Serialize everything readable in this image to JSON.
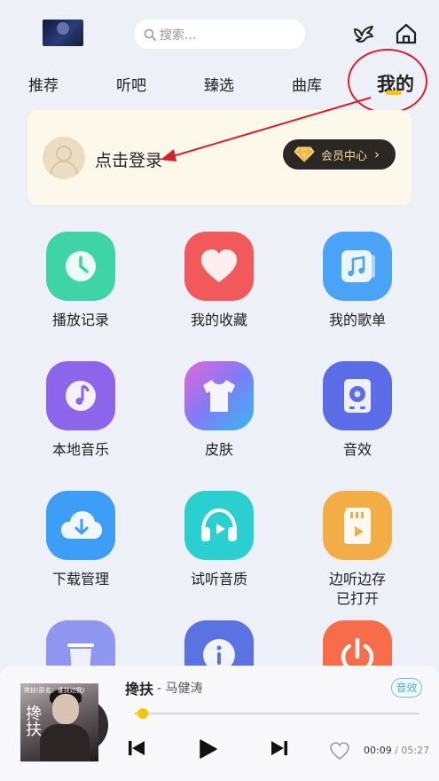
{
  "header": {
    "search_placeholder": "搜索...",
    "tabs": [
      {
        "label": "推荐"
      },
      {
        "label": "听吧"
      },
      {
        "label": "臻选"
      },
      {
        "label": "曲库"
      },
      {
        "label": "我的",
        "active": true
      }
    ]
  },
  "login_card": {
    "login_text": "点击登录",
    "vip_label": "会员中心"
  },
  "grid": [
    {
      "label": "播放记录",
      "icon": "clock-icon",
      "color": "#3fd4a5"
    },
    {
      "label": "我的收藏",
      "icon": "heart-icon",
      "color": "#f2595a"
    },
    {
      "label": "我的歌单",
      "icon": "playlist-icon",
      "color": "#4aa3f6"
    },
    {
      "label": "本地音乐",
      "icon": "music-note-icon",
      "color": "#8d65ea"
    },
    {
      "label": "皮肤",
      "icon": "tshirt-icon",
      "color": "#6c7cf5"
    },
    {
      "label": "音效",
      "icon": "speaker-icon",
      "color": "#5a6ce6"
    },
    {
      "label": "下载管理",
      "icon": "cloud-download-icon",
      "color": "#3d9ef7"
    },
    {
      "label": "试听音质",
      "icon": "headphones-icon",
      "color": "#2ad0cf"
    },
    {
      "label": "边听边存",
      "sublabel": "已打开",
      "icon": "sd-card-icon",
      "color": "#f3ad47"
    },
    {
      "label": "",
      "icon": "trash-icon",
      "color": "#8f96f0"
    },
    {
      "label": "",
      "icon": "info-icon",
      "color": "#5b72e3"
    },
    {
      "label": "",
      "icon": "power-icon",
      "color": "#f86c4a"
    }
  ],
  "player": {
    "song_title": "搀扶",
    "artist": "- 马健涛",
    "fx_badge": "音效",
    "cover_title": "搀扶(原名：谁扶过我)",
    "cover_big": "搀扶",
    "progress": 0.0285,
    "current_time": "00:09",
    "total_time": "/ 05:27"
  },
  "colors": {
    "accent": "#ffc400",
    "annotation": "#d8202a"
  }
}
